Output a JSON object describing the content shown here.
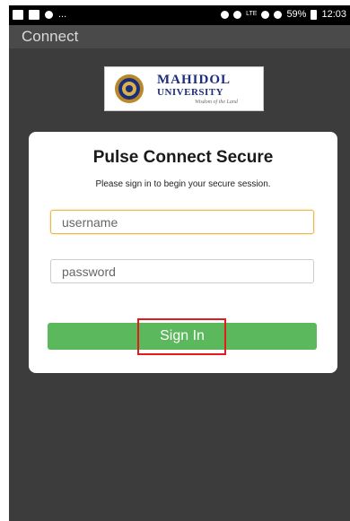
{
  "status_bar": {
    "left_ellipsis": "...",
    "battery_percent": "59%",
    "time": "12:03",
    "network_label": "LTE"
  },
  "app_bar": {
    "title": "Connect"
  },
  "logo": {
    "line1": "MAHIDOL",
    "line2": "UNIVERSITY",
    "tagline": "Wisdom of the Land"
  },
  "login": {
    "title": "Pulse Connect Secure",
    "subtitle": "Please sign in to begin your secure session.",
    "username_placeholder": "username",
    "password_placeholder": "password",
    "sign_in_label": "Sign In"
  },
  "colors": {
    "sign_in_button": "#5cb85c",
    "highlight_box": "#e31b1b",
    "background": "#3c3c3c"
  }
}
